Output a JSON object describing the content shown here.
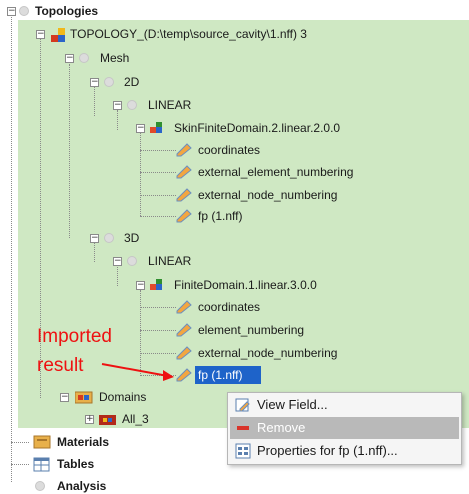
{
  "tree": {
    "topologies": "Topologies",
    "topology": "TOPOLOGY_(D:\\temp\\source_cavity\\1.nff) 3",
    "mesh": "Mesh",
    "d2": "2D",
    "linear2": "LINEAR",
    "skin_domain": "SkinFiniteDomain.2.linear.2.0.0",
    "skin_fields": [
      "coordinates",
      "external_element_numbering",
      "external_node_numbering",
      "fp (1.nff)"
    ],
    "d3": "3D",
    "linear3": "LINEAR",
    "finite_domain": "FiniteDomain.1.linear.3.0.0",
    "finite_fields": [
      "coordinates",
      "element_numbering",
      "external_node_numbering",
      "fp (1.nff)"
    ],
    "domains": "Domains",
    "all3": "All_3",
    "materials": "Materials",
    "tables": "Tables",
    "analysis": "Analysis"
  },
  "annotation": {
    "line1": "Imported",
    "line2": "result",
    "color": "#ee1111"
  },
  "context_menu": {
    "items": [
      "View Field...",
      "Remove",
      "Properties for fp (1.nff)..."
    ]
  },
  "colors": {
    "tree_background": "#cfe8c3",
    "selection": "#1e63c9",
    "menu_hover": "#b9b9b9"
  }
}
